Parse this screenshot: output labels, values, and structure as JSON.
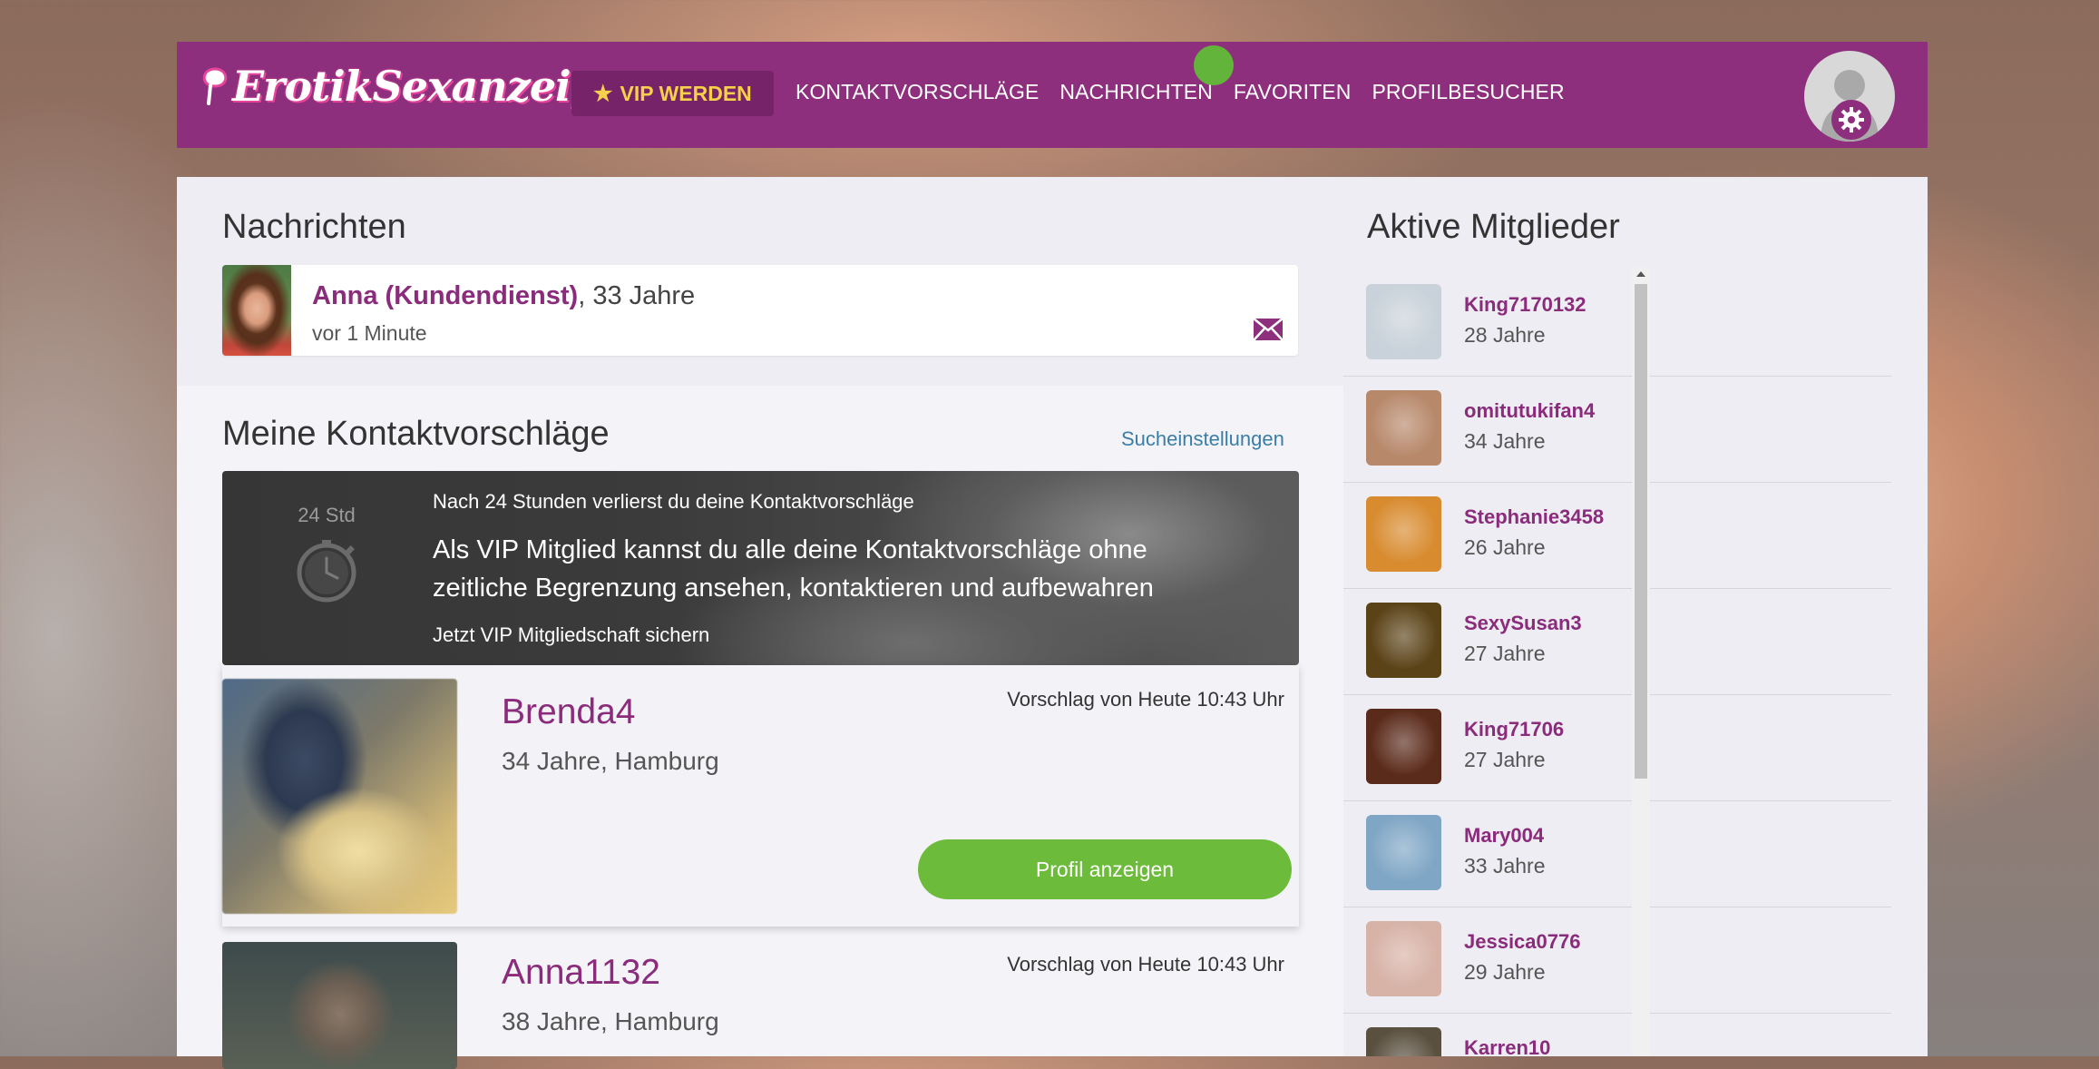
{
  "header": {
    "logo_text": "ErotikSexanzeigen",
    "vip_label": "VIP WERDEN",
    "nav": [
      "KONTAKTVORSCHLÄGE",
      "NACHRICHTEN",
      "FAVORITEN",
      "PROFILBESUCHER"
    ]
  },
  "messages": {
    "title": "Nachrichten",
    "item": {
      "name": "Anna (Kundendienst)",
      "age": ", 33 Jahre",
      "time": "vor 1 Minute"
    }
  },
  "suggestions": {
    "title": "Meine Kontaktvorschläge",
    "search_settings": "Sucheinstellungen",
    "banner": {
      "clock_label": "24 Std",
      "line1": "Nach 24 Stunden verlierst du deine Kontaktvorschläge",
      "line2": "Als VIP Mitglied kannst du alle deine Kontaktvorschläge ohne zeitliche Begrenzung ansehen, kontaktieren und aufbewahren",
      "line3": "Jetzt VIP Mitgliedschaft sichern"
    },
    "items": [
      {
        "name": "Brenda4",
        "meta": "34 Jahre, Hamburg",
        "date": "Vorschlag von Heute 10:43 Uhr",
        "button": "Profil anzeigen"
      },
      {
        "name": "Anna1132",
        "meta": "38 Jahre, Hamburg",
        "date": "Vorschlag von Heute 10:43 Uhr"
      }
    ]
  },
  "active_members": {
    "title": "Aktive Mitglieder",
    "members": [
      {
        "name": "King7170132",
        "age": "28 Jahre",
        "color": "#c9d2da"
      },
      {
        "name": "omitutukifan4",
        "age": "34 Jahre",
        "color": "#b7886a"
      },
      {
        "name": "Stephanie3458",
        "age": "26 Jahre",
        "color": "#d88b2f"
      },
      {
        "name": "SexySusan3",
        "age": "27 Jahre",
        "color": "#5b4318"
      },
      {
        "name": "King71706",
        "age": "27 Jahre",
        "color": "#5a2a1a"
      },
      {
        "name": "Mary004",
        "age": "33 Jahre",
        "color": "#7fa6c5"
      },
      {
        "name": "Jessica0776",
        "age": "29 Jahre",
        "color": "#d7b2a6"
      },
      {
        "name": "Karren10",
        "age": "",
        "color": "#5a5040"
      }
    ]
  },
  "colors": {
    "brand": "#8d2f7d",
    "accent_name": "#8a2b7b",
    "vip_gold": "#f6cf4b",
    "button_green": "#6cbb3a",
    "online": "#63b43a"
  }
}
